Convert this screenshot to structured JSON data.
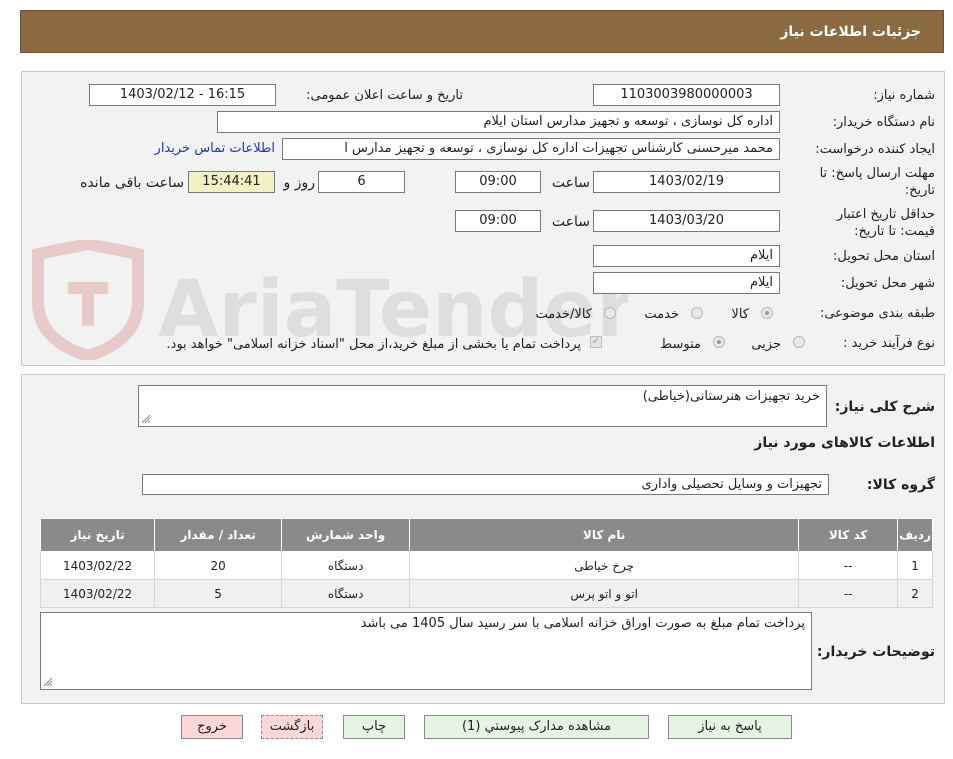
{
  "header": {
    "title": "جزئیات اطلاعات نیاز"
  },
  "watermark": {
    "text": "AriaTender.net"
  },
  "form": {
    "need_number_label": "شماره نیاز:",
    "need_number": "1103003980000003",
    "announce_label": "تاریخ و ساعت اعلان عمومی:",
    "announce_value": "1403/02/12 - 16:15",
    "buyer_org_label": "نام دستگاه خریدار:",
    "buyer_org": "اداره کل نوسازی ، توسعه و تجهیز مدارس استان ایلام",
    "requester_label": "ایجاد کننده درخواست:",
    "requester": "محمد میرحسنی کارشناس تجهیزات اداره کل نوسازی ، توسعه و تجهیز مدارس ا",
    "buyer_contact_link": "اطلاعات تماس خریدار",
    "deadline_label_1": "مهلت ارسال پاسخ: تا",
    "deadline_label_2": "تاریخ:",
    "deadline_date": "1403/02/19",
    "time_label": "ساعت",
    "deadline_time": "09:00",
    "days_value": "6",
    "days_label": "روز و",
    "remaining_time": "15:44:41",
    "remaining_label": "ساعت باقی مانده",
    "validity_label_1": "حداقل تاریخ اعتبار",
    "validity_label_2": "قیمت: تا تاریخ:",
    "validity_date": "1403/03/20",
    "validity_time": "09:00",
    "province_label": "استان محل تحویل:",
    "province": "ایلام",
    "city_label": "شهر محل تحویل:",
    "city": "ایلام",
    "category_label": "طبقه بندی موضوعی:",
    "category_options": [
      "کالا",
      "خدمت",
      "کالا/خدمت"
    ],
    "category_selected": "کالا",
    "process_label": "نوع فرآیند خرید :",
    "process_options": [
      "جزیی",
      "متوسط"
    ],
    "process_selected": "متوسط",
    "payment_note": "پرداخت تمام یا بخشی از مبلغ خرید،از محل \"اسناد خزانه اسلامی\" خواهد بود."
  },
  "description": {
    "label": "شرح کلی نیاز:",
    "value": "خرید تجهیزات هنرستانی(خیاطی)"
  },
  "goods": {
    "section_title": "اطلاعات کالاهای مورد نیاز",
    "group_label": "گروه کالا:",
    "group_value": "تجهیزات و وسایل تحصیلی واداری",
    "columns": [
      "ردیف",
      "کد کالا",
      "نام کالا",
      "واحد شمارش",
      "تعداد / مقدار",
      "تاریخ نیاز"
    ],
    "rows": [
      [
        "1",
        "--",
        "چرخ خیاطی",
        "دستگاه",
        "20",
        "1403/02/22"
      ],
      [
        "2",
        "--",
        "اتو و اتو پرس",
        "دستگاه",
        "5",
        "1403/02/22"
      ]
    ]
  },
  "buyer_notes": {
    "label": "توضیحات خریدار:",
    "value": "پرداخت تمام مبلغ به صورت اوراق خزانه اسلامی با سر رسید سال 1405 می باشد"
  },
  "buttons": {
    "reply": "پاسخ به نیاز",
    "attachments": "مشاهده مدارک پیوستي (1)",
    "print": "چاپ",
    "back": "بازگشت",
    "exit": "خروج"
  },
  "colors": {
    "header_bg": "#8b6a42",
    "link": "#1a35c8",
    "table_header": "#8a8a8a",
    "button_green": "#e6f5e3",
    "button_pink": "#fbd7d7"
  }
}
